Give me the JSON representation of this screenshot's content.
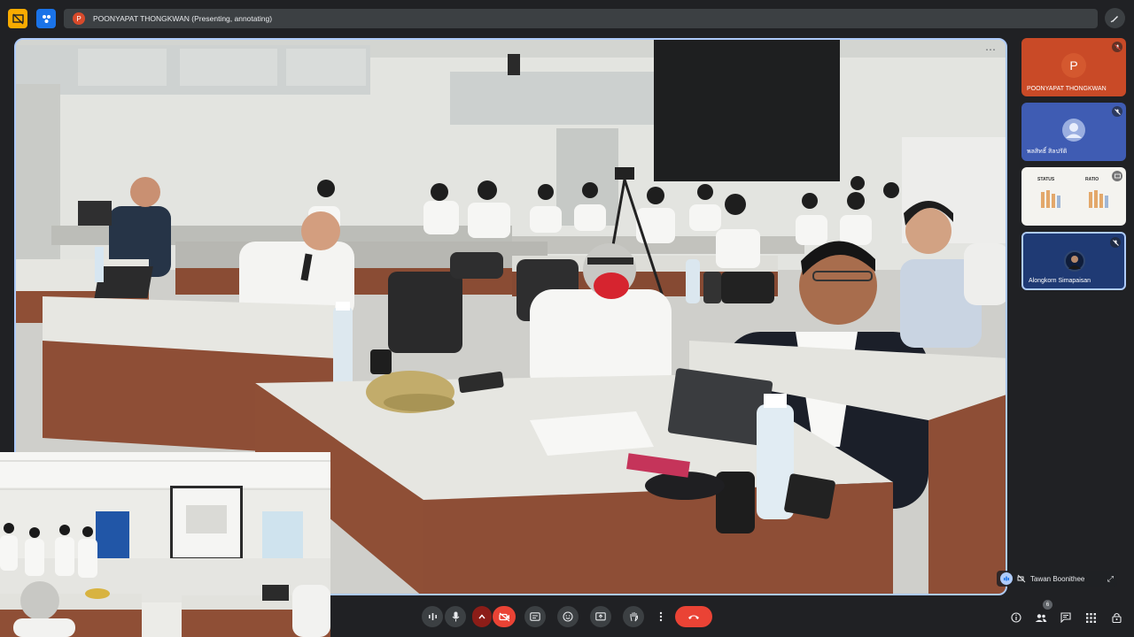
{
  "top_bar": {
    "presenter_initial": "P",
    "presenter_text": "POONYAPAT THONGKWAN (Presenting, annotating)"
  },
  "stage": {
    "speaker_name": "Tawan Boonithee"
  },
  "participants": [
    {
      "name": "POONYAPAT THONGKWAN",
      "initial": "P"
    },
    {
      "name": "พลสิทธิ์ สิลปรัติ"
    },
    {
      "name": "",
      "slide_labels": [
        "STATUS",
        "RATIO"
      ]
    },
    {
      "name": "Alongkorn Simapaisan"
    }
  ],
  "controls": {
    "participant_count": "6"
  }
}
